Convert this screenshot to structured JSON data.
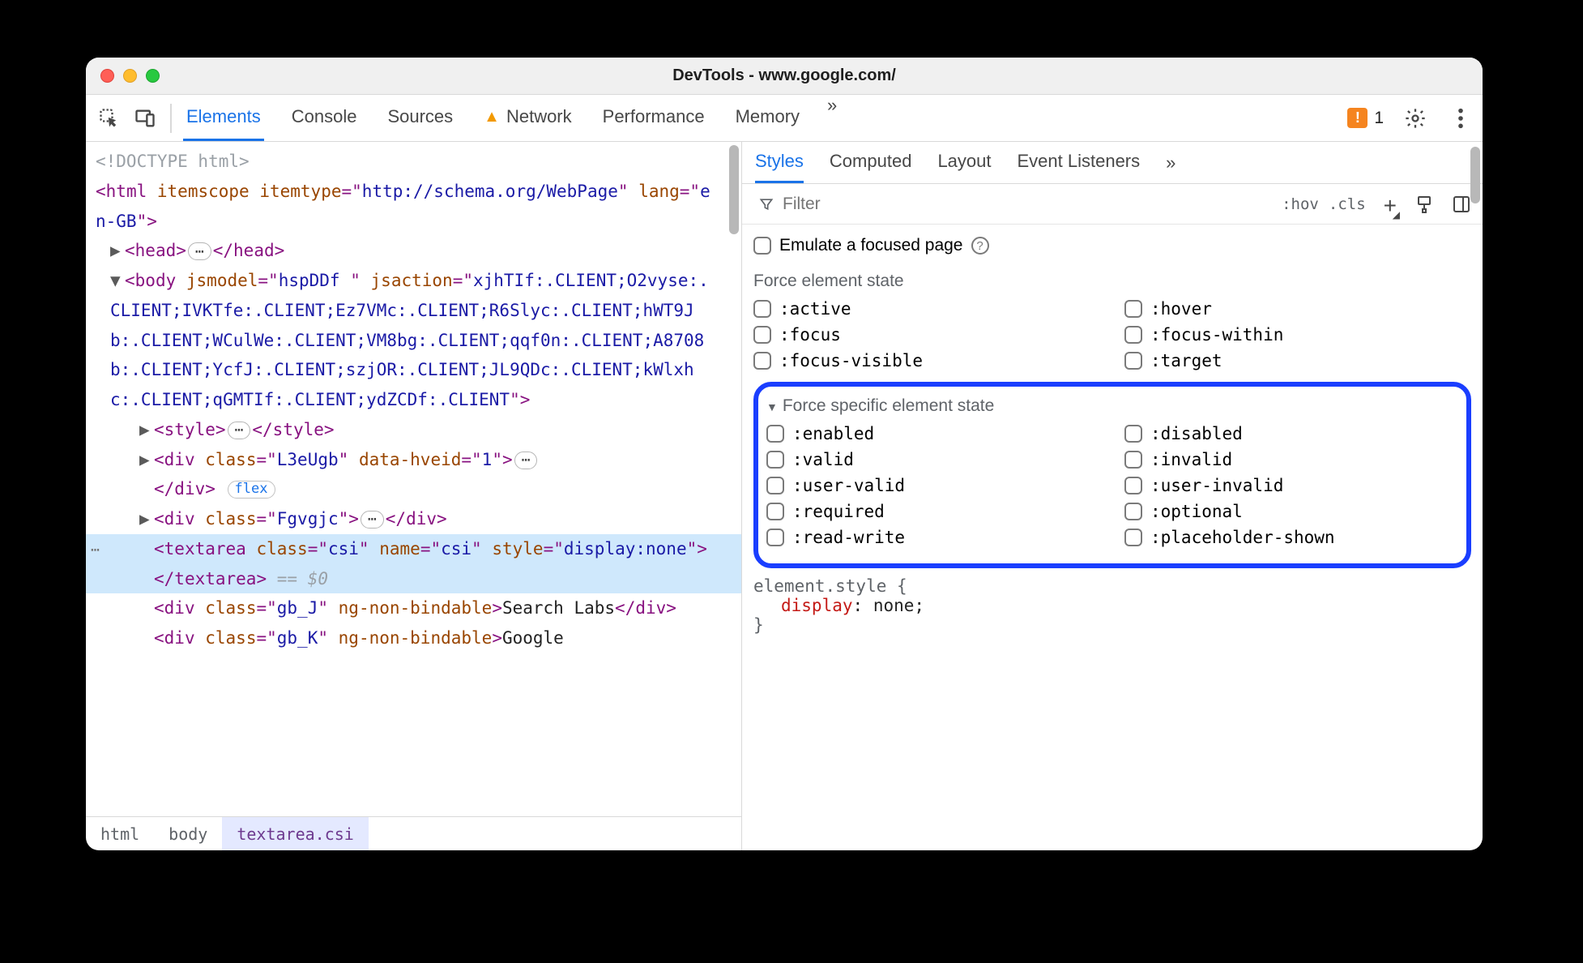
{
  "window": {
    "title": "DevTools - www.google.com/"
  },
  "toolbar": {
    "tabs": [
      "Elements",
      "Console",
      "Sources",
      "Network",
      "Performance",
      "Memory"
    ],
    "active_tab": "Elements",
    "network_has_warning": true,
    "issues_count": "1"
  },
  "dom": {
    "doctype": "<!DOCTYPE html>",
    "html_open": "<html itemscope itemtype=\"http://schema.org/WebPage\" lang=\"en-GB\">",
    "head": {
      "tag": "head"
    },
    "body_open": "<body jsmodel=\"hspDDf \" jsaction=\"xjhTIf:.CLIENT;O2vyse:.CLIENT;IVKTfe:.CLIENT;Ez7VMc:.CLIENT;R6Slyc:.CLIENT;hWT9Jb:.CLIENT;WCulWe:.CLIENT;VM8bg:.CLIENT;qqf0n:.CLIENT;A8708b:.CLIENT;YcfJ:.CLIENT;szjOR:.CLIENT;JL9QDc:.CLIENT;kWlxhc:.CLIENT;qGMTIf:.CLIENT;ydZCDf:.CLIENT\">",
    "children": [
      {
        "type": "style",
        "raw": "<style>…</style>"
      },
      {
        "type": "div",
        "class": "L3eUgb",
        "extra": "data-hveid=\"1\"",
        "flex": true
      },
      {
        "type": "div",
        "class": "Fgvgjc"
      },
      {
        "type": "textarea_sel",
        "class": "csi",
        "nameattr": "csi",
        "style": "display:none",
        "dollar0": "== $0"
      },
      {
        "type": "div_text",
        "class": "gb_J",
        "extra_attr": "ng-non-bindable",
        "text": "Search Labs"
      },
      {
        "type": "div_text_partial",
        "class": "gb_K",
        "extra_attr": "ng-non-bindable",
        "text": "Google"
      }
    ]
  },
  "breadcrumb": [
    "html",
    "body",
    "textarea.csi"
  ],
  "right": {
    "tabs": [
      "Styles",
      "Computed",
      "Layout",
      "Event Listeners"
    ],
    "active_tab": "Styles",
    "filter_placeholder": "Filter",
    "hov": ":hov",
    "cls": ".cls",
    "emulate_label": "Emulate a focused page",
    "force_state": {
      "heading": "Force element state",
      "items": [
        ":active",
        ":hover",
        ":focus",
        ":focus-within",
        ":focus-visible",
        ":target"
      ]
    },
    "force_specific": {
      "heading": "Force specific element state",
      "items": [
        ":enabled",
        ":disabled",
        ":valid",
        ":invalid",
        ":user-valid",
        ":user-invalid",
        ":required",
        ":optional",
        ":read-write",
        ":placeholder-shown"
      ]
    },
    "element_style": {
      "selector": "element.style",
      "prop": "display",
      "val": "none"
    }
  }
}
